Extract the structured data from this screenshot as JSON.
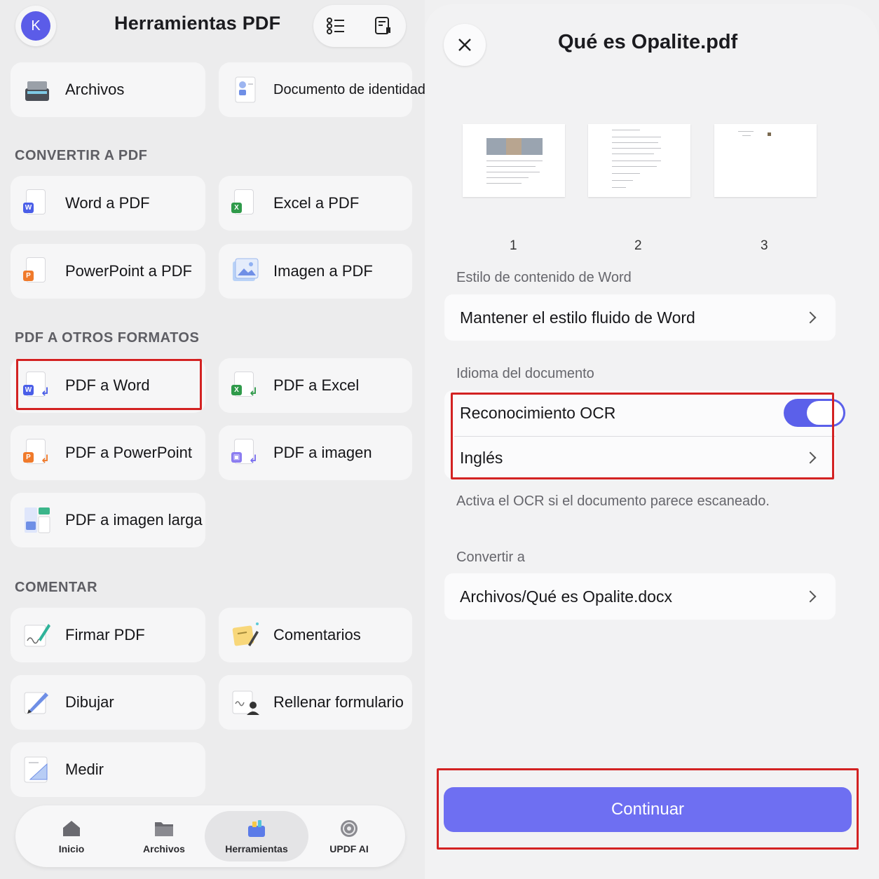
{
  "left": {
    "avatar_letter": "K",
    "title": "Herramientas PDF",
    "top_cards": [
      {
        "label": "Archivos"
      },
      {
        "label": "Documento de identidad"
      }
    ],
    "sections": {
      "convertir": "CONVERTIR A PDF",
      "otros": "PDF A OTROS FORMATOS",
      "comentar": "COMENTAR"
    },
    "convertir_items": [
      {
        "label": "Word a PDF",
        "badge": "W"
      },
      {
        "label": "Excel a PDF",
        "badge": "X"
      },
      {
        "label": "PowerPoint a PDF",
        "badge": "P"
      },
      {
        "label": "Imagen a PDF"
      }
    ],
    "otros_items": [
      {
        "label": "PDF a Word",
        "badge": "W"
      },
      {
        "label": "PDF a Excel",
        "badge": "X"
      },
      {
        "label": "PDF a PowerPoint",
        "badge": "P"
      },
      {
        "label": "PDF a imagen"
      },
      {
        "label": "PDF a imagen larga"
      }
    ],
    "comentar_items": [
      {
        "label": "Firmar PDF"
      },
      {
        "label": "Comentarios"
      },
      {
        "label": "Dibujar"
      },
      {
        "label": "Rellenar formulario"
      },
      {
        "label": "Medir"
      }
    ],
    "tabs": [
      {
        "label": "Inicio"
      },
      {
        "label": "Archivos"
      },
      {
        "label": "Herramientas",
        "active": true
      },
      {
        "label": "UPDF AI"
      }
    ]
  },
  "right": {
    "title": "Qué es Opalite.pdf",
    "pages": [
      "1",
      "2",
      "3"
    ],
    "style_label": "Estilo de contenido de Word",
    "style_value": "Mantener el estilo fluido de Word",
    "language_label": "Idioma del documento",
    "ocr_label": "Reconocimiento OCR",
    "ocr_enabled": true,
    "language_value": "Inglés",
    "ocr_hint": "Activa el OCR si el documento parece escaneado.",
    "convert_label": "Convertir a",
    "convert_value": "Archivos/Qué es Opalite.docx",
    "continue_label": "Continuar"
  },
  "colors": {
    "accent": "#6e6ff2",
    "highlight": "#d32222",
    "word": "#4a5ee8",
    "excel": "#2f9a4a",
    "powerpoint": "#f07a2b"
  }
}
